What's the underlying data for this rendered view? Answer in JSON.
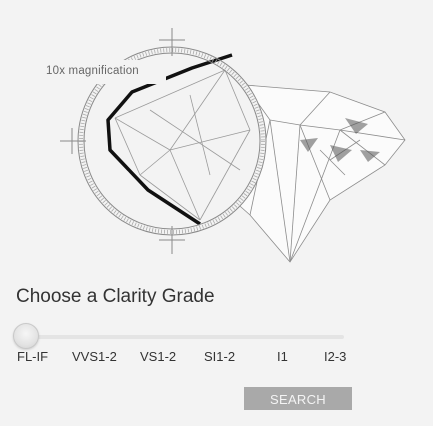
{
  "illustration": {
    "magnification_label": "10x magnification"
  },
  "heading": "Choose a Clarity Grade",
  "slider": {
    "selected_index": 0,
    "grades": [
      "FL-IF",
      "VVS1-2",
      "VS1-2",
      "SI1-2",
      "I1",
      "I2-3"
    ]
  },
  "search_label": "SEARCH",
  "colors": {
    "button_bg": "#a9a9a9",
    "button_text": "#f4f4f4",
    "track": "#e4e4e4",
    "page_bg": "#f3f3f3"
  }
}
